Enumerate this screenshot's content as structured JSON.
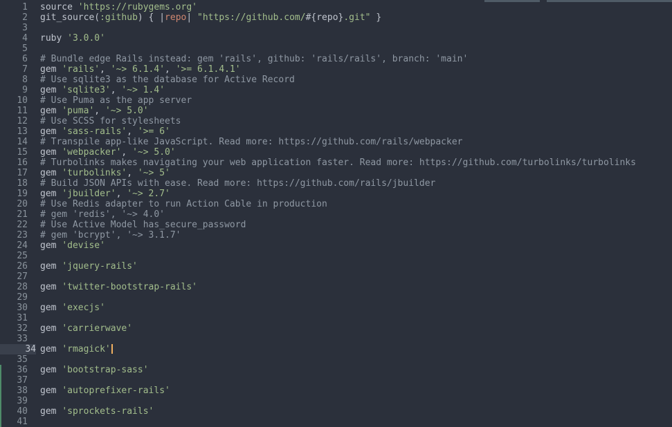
{
  "editor": {
    "lines": [
      {
        "n": "1",
        "code": [
          {
            "c": "t-kw",
            "t": "source "
          },
          {
            "c": "t-str",
            "t": "'https://rubygems.org'"
          }
        ]
      },
      {
        "n": "2",
        "code": [
          {
            "c": "t-kw",
            "t": "git_source"
          },
          {
            "c": "t-kw",
            "t": "("
          },
          {
            "c": "t-sym",
            "t": ":github"
          },
          {
            "c": "t-kw",
            "t": ") { "
          },
          {
            "c": "t-pipe",
            "t": "|"
          },
          {
            "c": "t-var",
            "t": "repo"
          },
          {
            "c": "t-pipe",
            "t": "| "
          },
          {
            "c": "t-str",
            "t": "\"https://github.com/"
          },
          {
            "c": "t-interp",
            "t": "#{repo}"
          },
          {
            "c": "t-str",
            "t": ".git\""
          },
          {
            "c": "t-kw",
            "t": " }"
          }
        ]
      },
      {
        "n": "3",
        "code": []
      },
      {
        "n": "4",
        "code": [
          {
            "c": "t-kw",
            "t": "ruby "
          },
          {
            "c": "t-str",
            "t": "'3.0.0'"
          }
        ]
      },
      {
        "n": "5",
        "code": []
      },
      {
        "n": "6",
        "code": [
          {
            "c": "t-com",
            "t": "# Bundle edge Rails instead: gem 'rails', github: 'rails/rails', branch: 'main'"
          }
        ]
      },
      {
        "n": "7",
        "code": [
          {
            "c": "t-kw",
            "t": "gem "
          },
          {
            "c": "t-str",
            "t": "'rails'"
          },
          {
            "c": "t-kw",
            "t": ", "
          },
          {
            "c": "t-str",
            "t": "'~> 6.1.4'"
          },
          {
            "c": "t-kw",
            "t": ", "
          },
          {
            "c": "t-str",
            "t": "'>= 6.1.4.1'"
          }
        ]
      },
      {
        "n": "8",
        "code": [
          {
            "c": "t-com",
            "t": "# Use sqlite3 as the database for Active Record"
          }
        ]
      },
      {
        "n": "9",
        "code": [
          {
            "c": "t-kw",
            "t": "gem "
          },
          {
            "c": "t-str",
            "t": "'sqlite3'"
          },
          {
            "c": "t-kw",
            "t": ", "
          },
          {
            "c": "t-str",
            "t": "'~> 1.4'"
          }
        ]
      },
      {
        "n": "10",
        "code": [
          {
            "c": "t-com",
            "t": "# Use Puma as the app server"
          }
        ]
      },
      {
        "n": "11",
        "code": [
          {
            "c": "t-kw",
            "t": "gem "
          },
          {
            "c": "t-str",
            "t": "'puma'"
          },
          {
            "c": "t-kw",
            "t": ", "
          },
          {
            "c": "t-str",
            "t": "'~> 5.0'"
          }
        ]
      },
      {
        "n": "12",
        "code": [
          {
            "c": "t-com",
            "t": "# Use SCSS for stylesheets"
          }
        ]
      },
      {
        "n": "13",
        "code": [
          {
            "c": "t-kw",
            "t": "gem "
          },
          {
            "c": "t-str",
            "t": "'sass-rails'"
          },
          {
            "c": "t-kw",
            "t": ", "
          },
          {
            "c": "t-str",
            "t": "'>= 6'"
          }
        ]
      },
      {
        "n": "14",
        "code": [
          {
            "c": "t-com",
            "t": "# Transpile app-like JavaScript. Read more: https://github.com/rails/webpacker"
          }
        ]
      },
      {
        "n": "15",
        "code": [
          {
            "c": "t-kw",
            "t": "gem "
          },
          {
            "c": "t-str",
            "t": "'webpacker'"
          },
          {
            "c": "t-kw",
            "t": ", "
          },
          {
            "c": "t-str",
            "t": "'~> 5.0'"
          }
        ]
      },
      {
        "n": "16",
        "code": [
          {
            "c": "t-com",
            "t": "# Turbolinks makes navigating your web application faster. Read more: https://github.com/turbolinks/turbolinks"
          }
        ]
      },
      {
        "n": "17",
        "code": [
          {
            "c": "t-kw",
            "t": "gem "
          },
          {
            "c": "t-str",
            "t": "'turbolinks'"
          },
          {
            "c": "t-kw",
            "t": ", "
          },
          {
            "c": "t-str",
            "t": "'~> 5'"
          }
        ]
      },
      {
        "n": "18",
        "code": [
          {
            "c": "t-com",
            "t": "# Build JSON APIs with ease. Read more: https://github.com/rails/jbuilder"
          }
        ]
      },
      {
        "n": "19",
        "code": [
          {
            "c": "t-kw",
            "t": "gem "
          },
          {
            "c": "t-str",
            "t": "'jbuilder'"
          },
          {
            "c": "t-kw",
            "t": ", "
          },
          {
            "c": "t-str",
            "t": "'~> 2.7'"
          }
        ]
      },
      {
        "n": "20",
        "code": [
          {
            "c": "t-com",
            "t": "# Use Redis adapter to run Action Cable in production"
          }
        ]
      },
      {
        "n": "21",
        "code": [
          {
            "c": "t-com",
            "t": "# gem 'redis', '~> 4.0'"
          }
        ]
      },
      {
        "n": "22",
        "code": [
          {
            "c": "t-com",
            "t": "# Use Active Model has_secure_password"
          }
        ]
      },
      {
        "n": "23",
        "code": [
          {
            "c": "t-com",
            "t": "# gem 'bcrypt', '~> 3.1.7'"
          }
        ]
      },
      {
        "n": "24",
        "code": [
          {
            "c": "t-kw",
            "t": "gem "
          },
          {
            "c": "t-str",
            "t": "'devise'"
          }
        ]
      },
      {
        "n": "25",
        "code": []
      },
      {
        "n": "26",
        "code": [
          {
            "c": "t-kw",
            "t": "gem "
          },
          {
            "c": "t-str",
            "t": "'jquery-rails'"
          }
        ]
      },
      {
        "n": "27",
        "code": []
      },
      {
        "n": "28",
        "code": [
          {
            "c": "t-kw",
            "t": "gem "
          },
          {
            "c": "t-str",
            "t": "'twitter-bootstrap-rails'"
          }
        ]
      },
      {
        "n": "29",
        "code": []
      },
      {
        "n": "30",
        "code": [
          {
            "c": "t-kw",
            "t": "gem "
          },
          {
            "c": "t-str",
            "t": "'execjs'"
          }
        ]
      },
      {
        "n": "31",
        "code": []
      },
      {
        "n": "32",
        "code": [
          {
            "c": "t-kw",
            "t": "gem "
          },
          {
            "c": "t-str",
            "t": "'carrierwave'"
          }
        ]
      },
      {
        "n": "33",
        "code": []
      },
      {
        "n": "34",
        "code": [
          {
            "c": "t-kw",
            "t": "gem "
          },
          {
            "c": "t-str",
            "t": "'rmagick'"
          }
        ],
        "current": true,
        "cursor": true
      },
      {
        "n": "35",
        "code": []
      },
      {
        "n": "36",
        "code": [
          {
            "c": "t-kw",
            "t": "gem "
          },
          {
            "c": "t-str",
            "t": "'bootstrap-sass'"
          }
        ],
        "modified": true
      },
      {
        "n": "37",
        "code": [],
        "modified": true
      },
      {
        "n": "38",
        "code": [
          {
            "c": "t-kw",
            "t": "gem "
          },
          {
            "c": "t-str",
            "t": "'autoprefixer-rails'"
          }
        ],
        "modified": true
      },
      {
        "n": "39",
        "code": [],
        "modified": true
      },
      {
        "n": "40",
        "code": [
          {
            "c": "t-kw",
            "t": "gem "
          },
          {
            "c": "t-str",
            "t": "'sprockets-rails'"
          }
        ],
        "modified": true
      },
      {
        "n": "41",
        "code": [],
        "modified": true
      }
    ]
  }
}
